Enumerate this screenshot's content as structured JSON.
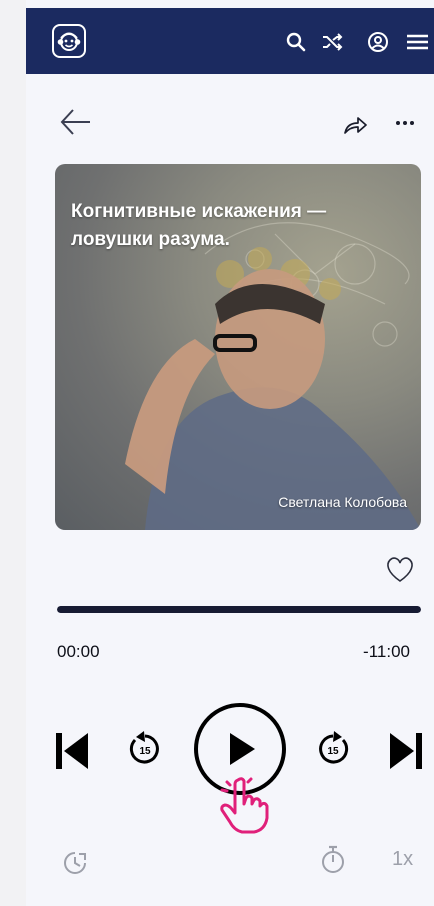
{
  "header": {
    "icons": [
      "monkey-logo-icon",
      "search-icon",
      "shuffle-icon",
      "profile-icon",
      "menu-icon"
    ]
  },
  "nav": {
    "icons": [
      "arrow-left-icon",
      "share-icon",
      "more-icon"
    ]
  },
  "book": {
    "title": "Когнитивные искажения — ловушки разума.",
    "author": "Светлана Колобова"
  },
  "player": {
    "elapsed": "00:00",
    "remaining": "-11:00",
    "progress": 1.0,
    "rewind_seconds": "15",
    "forward_seconds": "15",
    "speed": "1x"
  },
  "colors": {
    "header_bg": "#1b2a60",
    "progress": "#171b33",
    "cursor_hand": "#e0207a"
  }
}
